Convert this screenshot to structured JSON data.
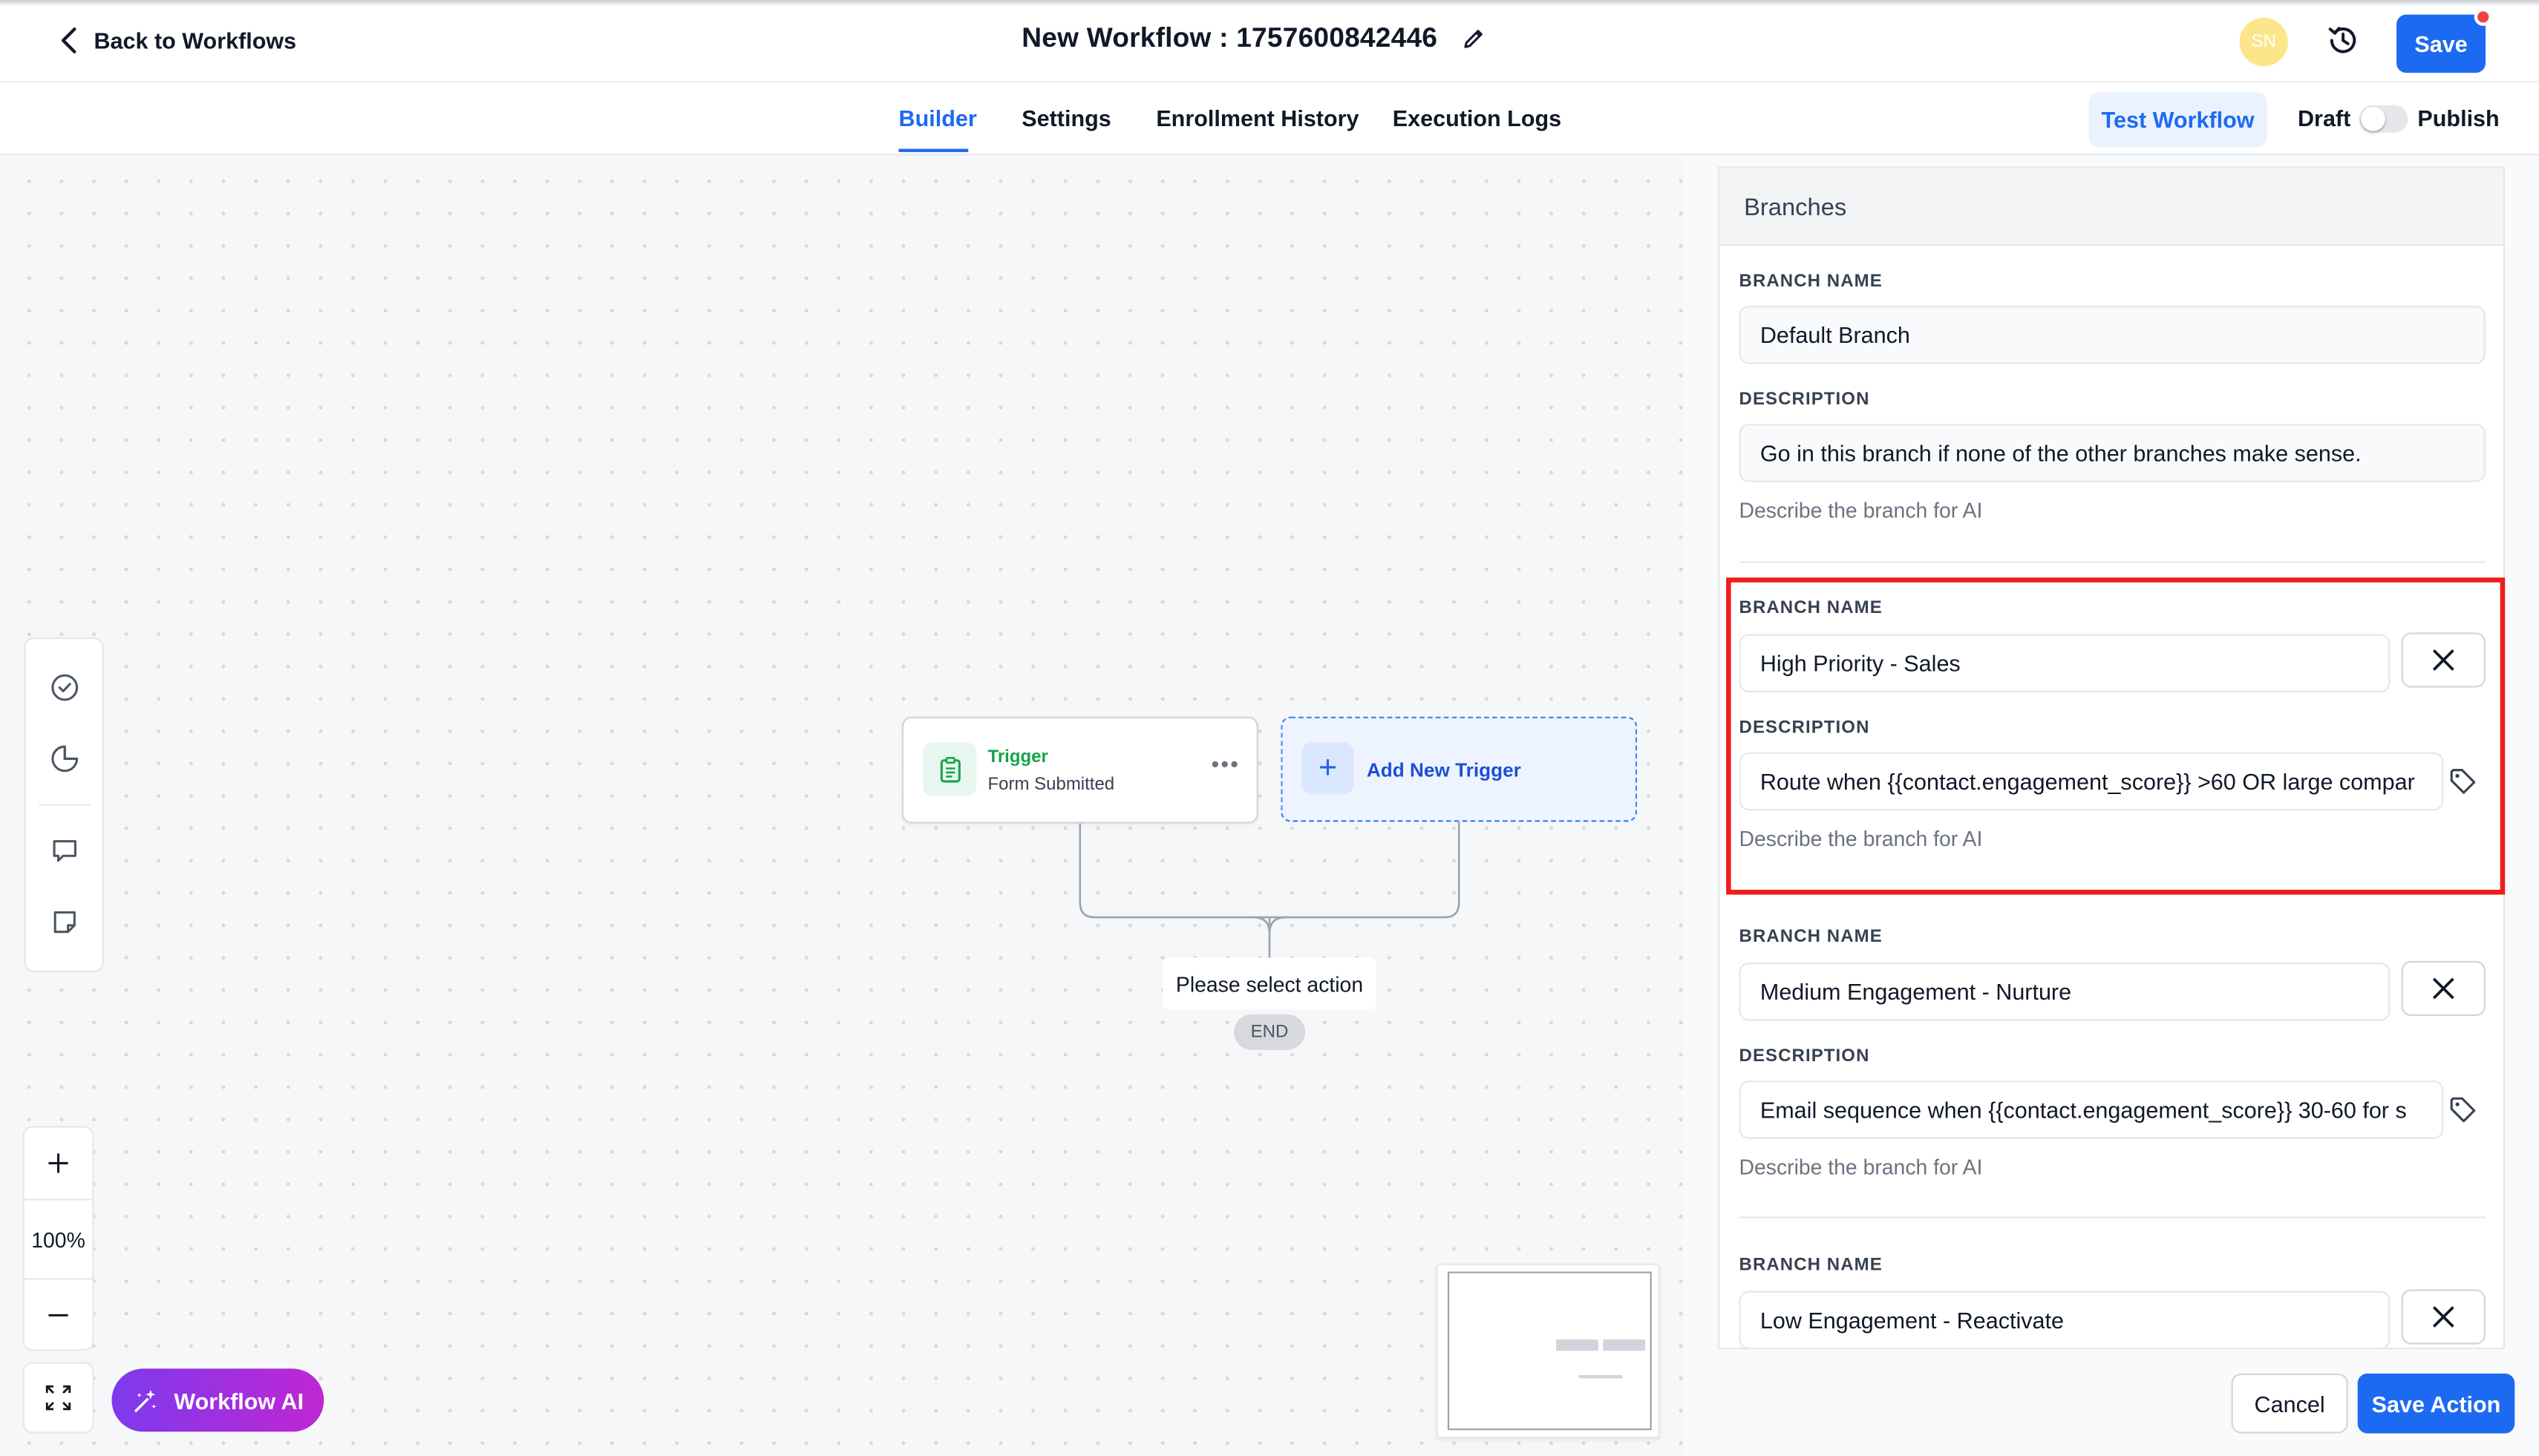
{
  "header": {
    "back_label": "Back to Workflows",
    "title": "New Workflow : 1757600842446",
    "avatar_initials": "SN",
    "save_label": "Save"
  },
  "tabs": [
    {
      "label": "Builder",
      "active": true
    },
    {
      "label": "Settings",
      "active": false
    },
    {
      "label": "Enrollment History",
      "active": false
    },
    {
      "label": "Execution Logs",
      "active": false
    }
  ],
  "actions": {
    "test_label": "Test Workflow",
    "draft_label": "Draft",
    "publish_label": "Publish",
    "published": false
  },
  "canvas": {
    "zoom": "100%",
    "trigger": {
      "title": "Trigger",
      "subtitle": "Form Submitted"
    },
    "add_trigger_label": "Add New Trigger",
    "select_action_label": "Please select action",
    "end_label": "END",
    "workflow_ai_label": "Workflow AI"
  },
  "panel": {
    "title": "Branches",
    "branch_name_label": "BRANCH NAME",
    "description_label": "DESCRIPTION",
    "helper_text": "Describe the branch for AI",
    "branches": [
      {
        "name": "Default Branch",
        "description": "Go in this branch if none of the other branches make sense."
      },
      {
        "name": "High Priority - Sales",
        "description": "Route when {{contact.engagement_score}} >60 OR large compar"
      },
      {
        "name": "Medium Engagement - Nurture",
        "description": "Email sequence when  {{contact.engagement_score}} 30-60 for s"
      },
      {
        "name": "Low Engagement - Reactivate",
        "description": ""
      }
    ],
    "cancel_label": "Cancel",
    "save_action_label": "Save Action"
  },
  "colors": {
    "accent": "#1d6af2",
    "highlight": "#ef1c1c",
    "trigger_green": "#16a34a",
    "ai_gradient_start": "#7c3aed",
    "ai_gradient_end": "#c026d3"
  }
}
